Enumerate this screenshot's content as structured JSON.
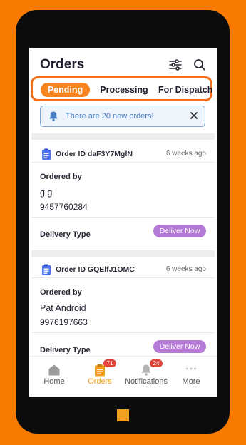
{
  "header": {
    "title": "Orders",
    "filter_icon": "sliders-icon",
    "search_icon": "search-icon"
  },
  "tabs": [
    {
      "label": "Pending",
      "active": true
    },
    {
      "label": "Processing",
      "active": false
    },
    {
      "label": "For Dispatch",
      "active": false
    }
  ],
  "banner": {
    "text": "There are 20 new orders!",
    "icon": "bell-icon",
    "close_icon": "close-icon"
  },
  "orders": [
    {
      "id": "Order ID daF3Y7MglN",
      "time": "6 weeks ago",
      "ordered_by_label": "Ordered by",
      "name": "g g",
      "phone": "9457760284",
      "delivery_label": "Delivery Type",
      "delivery_button": "Deliver Now"
    },
    {
      "id": "Order ID GQElfJ1OMC",
      "time": "6 weeks ago",
      "ordered_by_label": "Ordered by",
      "name": "Pat Android",
      "phone": "9976197663",
      "delivery_label": "Delivery Type",
      "delivery_button": "Deliver Now"
    }
  ],
  "bottom_nav": [
    {
      "label": "Home",
      "icon": "home-icon",
      "badge": null,
      "active": false
    },
    {
      "label": "Orders",
      "icon": "clipboard-icon",
      "badge": "71",
      "active": true
    },
    {
      "label": "Notifications",
      "icon": "bell-icon",
      "badge": "24",
      "active": false
    },
    {
      "label": "More",
      "icon": "more-dots-icon",
      "badge": null,
      "active": false
    }
  ],
  "colors": {
    "background": "#f97a00",
    "accent_orange": "#f7841e",
    "deliver_button": "#b47ad6",
    "banner_blue": "#4a7fc4",
    "order_icon_blue": "#4f73e8",
    "badge_red": "#e0453b"
  }
}
